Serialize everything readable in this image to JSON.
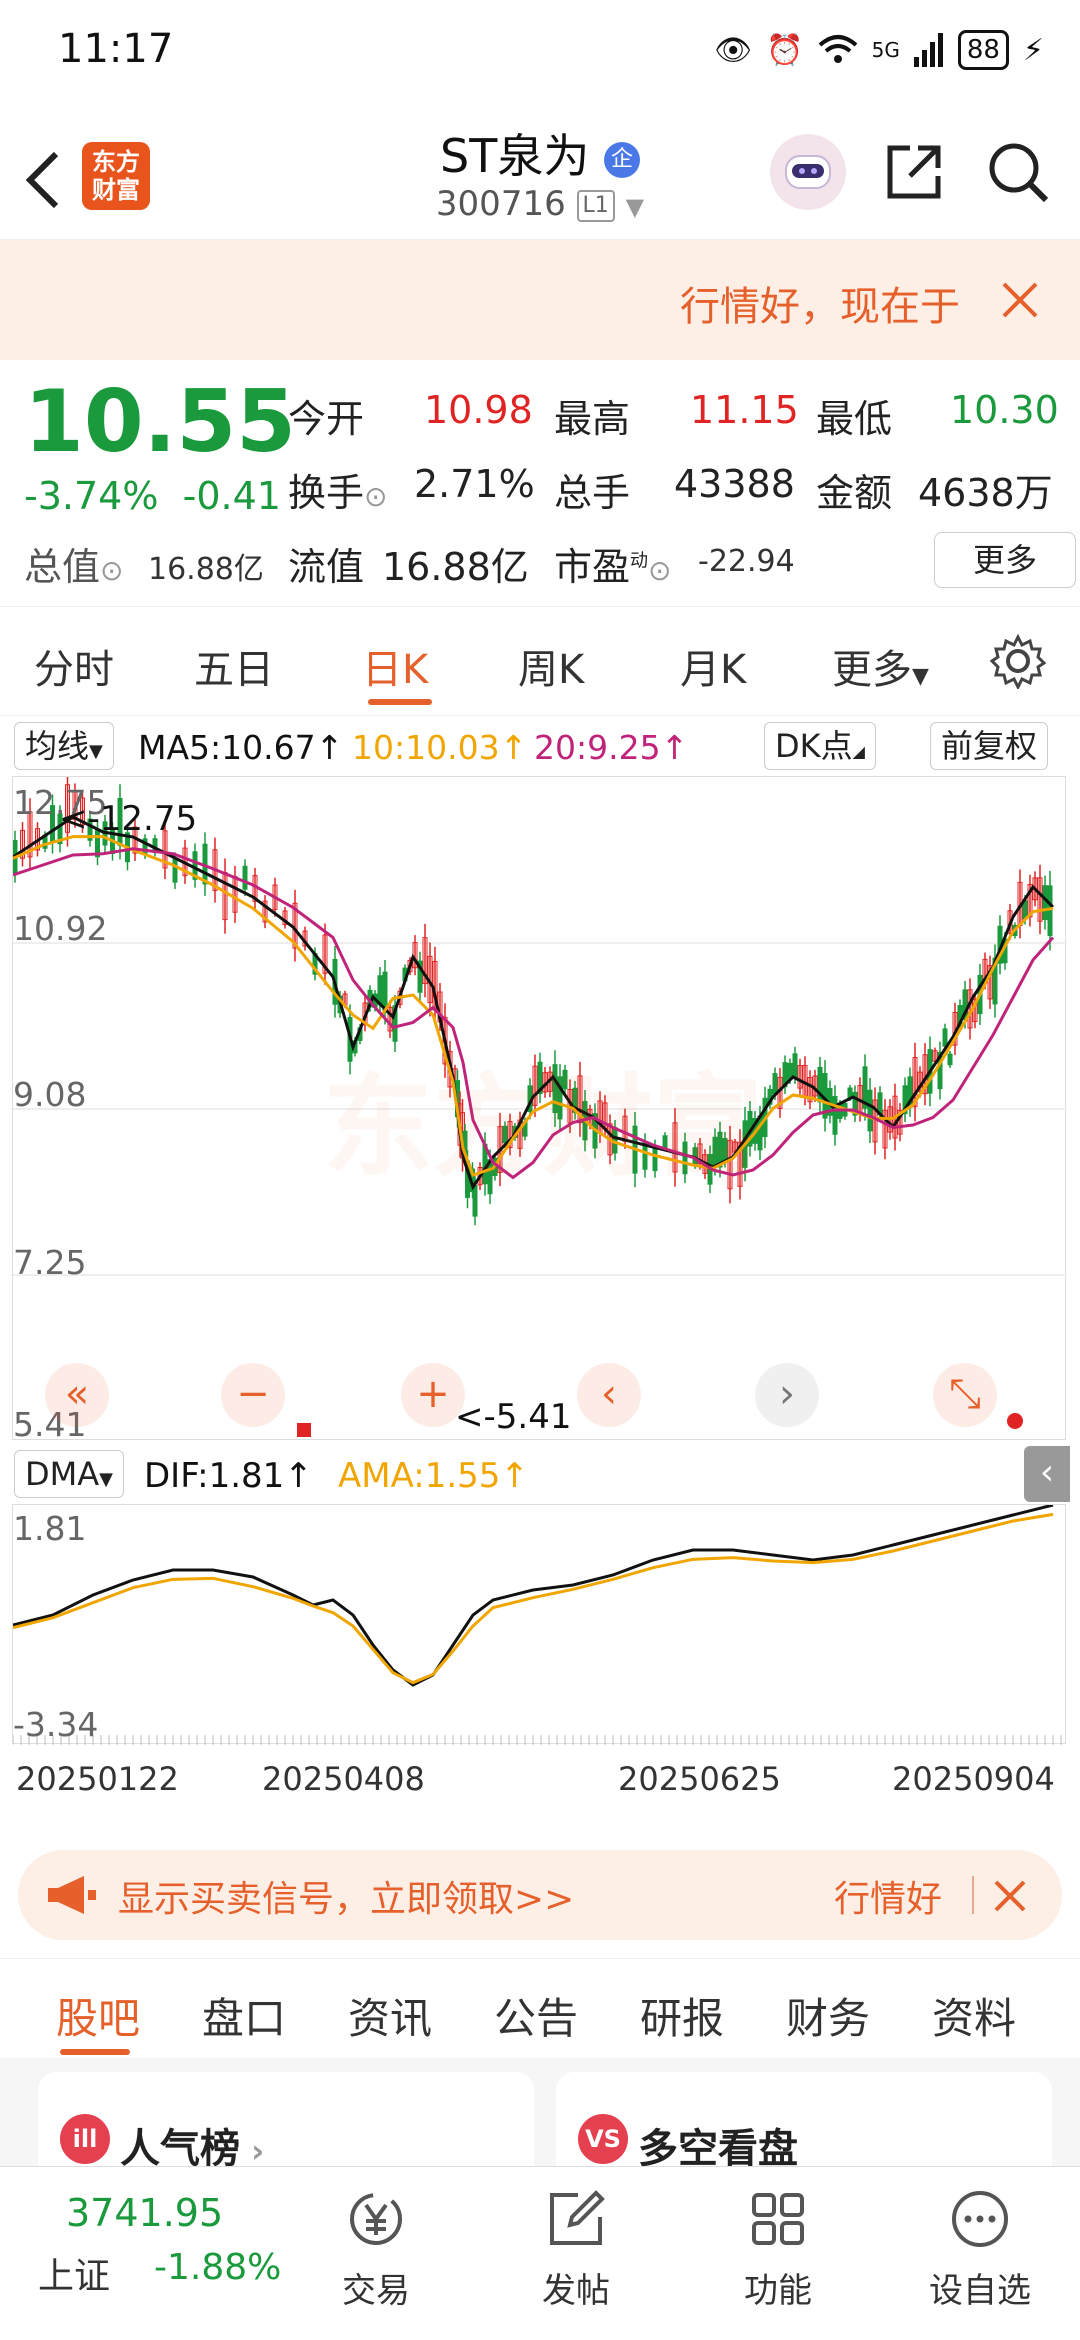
{
  "status": {
    "time": "11:17",
    "network": "5G",
    "battery": "88"
  },
  "header": {
    "logo_line1": "东方",
    "logo_line2": "财富",
    "title": "ST泉为",
    "badge": "企",
    "code": "300716",
    "market_tag": "L1"
  },
  "top_banner": {
    "text": "行情好，现在于"
  },
  "quote": {
    "price": "10.55",
    "change_pct": "-3.74%",
    "change": "-0.41",
    "open_label": "今开",
    "open": "10.98",
    "high_label": "最高",
    "high": "11.15",
    "low_label": "最低",
    "low": "10.30",
    "turnover_label": "换手",
    "turnover": "2.71%",
    "volume_label": "总手",
    "volume": "43388",
    "amount_label": "金额",
    "amount": "4638万",
    "mktcap_label": "总值",
    "mktcap": "16.88亿",
    "float_label": "流值",
    "float": "16.88亿",
    "pe_label": "市盈",
    "pe_sup": "动",
    "pe": "-22.94",
    "more": "更多"
  },
  "period_tabs": [
    "分时",
    "五日",
    "日K",
    "周K",
    "月K",
    "更多"
  ],
  "period_active": 2,
  "indicator_bar": {
    "ma_select": "均线",
    "ma5": "MA5:10.67↑",
    "ma10": "10:10.03↑",
    "ma20": "20:9.25↑",
    "dk": "DK点",
    "adjust": "前复权"
  },
  "main_chart": {
    "price_labels": [
      "12.75",
      "10.92",
      "9.08",
      "7.25",
      "5.41"
    ],
    "max_marker": "<-12.75",
    "min_marker": "<-5.41",
    "watermark": "东方财富"
  },
  "dma_bar": {
    "select": "DMA",
    "dif": "DIF:1.81↑",
    "ama": "AMA:1.55↑"
  },
  "dma_chart": {
    "top_label": "1.81",
    "bottom_label": "-3.34"
  },
  "dates": [
    "20250122",
    "20250408",
    "20250625",
    "20250904"
  ],
  "bottom_banner": {
    "text": "显示买卖信号，立即领取>>",
    "right": "行情好"
  },
  "section_tabs": [
    "股吧",
    "盘口",
    "资讯",
    "公告",
    "研报",
    "财务",
    "资料"
  ],
  "section_active": 0,
  "cards": {
    "popularity": "人气榜",
    "popularity_icon": "ill",
    "bullbear": "多空看盘",
    "bullbear_icon": "VS"
  },
  "bottom_nav": {
    "index_value": "3741.95",
    "index_name": "上证",
    "index_change": "-1.88%",
    "items": [
      "交易",
      "发帖",
      "功能",
      "设自选"
    ]
  },
  "colors": {
    "accent": "#e5602a",
    "up": "#e02424",
    "down": "#1a9a3c",
    "ma5": "#111111",
    "ma10": "#f0a500",
    "ma20": "#c0237a"
  }
}
